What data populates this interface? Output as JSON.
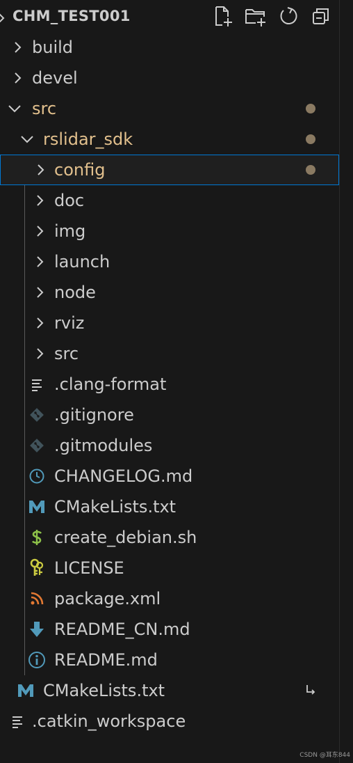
{
  "explorer": {
    "title": "CHM_TEST001",
    "actions": [
      {
        "name": "new-file",
        "icon": "new-file-icon"
      },
      {
        "name": "new-folder",
        "icon": "new-folder-icon"
      },
      {
        "name": "refresh",
        "icon": "refresh-icon"
      },
      {
        "name": "collapse-all",
        "icon": "collapse-all-icon"
      }
    ]
  },
  "tree": [
    {
      "label": "build",
      "type": "folder",
      "expanded": false,
      "depth": 0,
      "modified": false
    },
    {
      "label": "devel",
      "type": "folder",
      "expanded": false,
      "depth": 0,
      "modified": false
    },
    {
      "label": "src",
      "type": "folder",
      "expanded": true,
      "depth": 0,
      "modified": true
    },
    {
      "label": "rslidar_sdk",
      "type": "folder",
      "expanded": true,
      "depth": 1,
      "modified": true
    },
    {
      "label": "config",
      "type": "folder",
      "expanded": false,
      "depth": 2,
      "modified": true,
      "selected": true
    },
    {
      "label": "doc",
      "type": "folder",
      "expanded": false,
      "depth": 2,
      "modified": false
    },
    {
      "label": "img",
      "type": "folder",
      "expanded": false,
      "depth": 2,
      "modified": false
    },
    {
      "label": "launch",
      "type": "folder",
      "expanded": false,
      "depth": 2,
      "modified": false
    },
    {
      "label": "node",
      "type": "folder",
      "expanded": false,
      "depth": 2,
      "modified": false
    },
    {
      "label": "rviz",
      "type": "folder",
      "expanded": false,
      "depth": 2,
      "modified": false
    },
    {
      "label": "src",
      "type": "folder",
      "expanded": false,
      "depth": 2,
      "modified": false
    },
    {
      "label": ".clang-format",
      "type": "file",
      "icon": "lines-icon",
      "depth": 2
    },
    {
      "label": ".gitignore",
      "type": "file",
      "icon": "git-icon",
      "depth": 2
    },
    {
      "label": ".gitmodules",
      "type": "file",
      "icon": "git-icon",
      "depth": 2
    },
    {
      "label": "CHANGELOG.md",
      "type": "file",
      "icon": "clock-icon",
      "depth": 2
    },
    {
      "label": "CMakeLists.txt",
      "type": "file",
      "icon": "cmake-m-icon",
      "depth": 2
    },
    {
      "label": "create_debian.sh",
      "type": "file",
      "icon": "dollar-icon",
      "depth": 2
    },
    {
      "label": "LICENSE",
      "type": "file",
      "icon": "key-icon",
      "depth": 2
    },
    {
      "label": "package.xml",
      "type": "file",
      "icon": "rss-icon",
      "depth": 2
    },
    {
      "label": "README_CN.md",
      "type": "file",
      "icon": "download-arrow-icon",
      "depth": 2
    },
    {
      "label": "README.md",
      "type": "file",
      "icon": "info-icon",
      "depth": 2
    },
    {
      "label": "CMakeLists.txt",
      "type": "file",
      "icon": "cmake-m-icon",
      "depth": 1,
      "symlink": true
    },
    {
      "label": ".catkin_workspace",
      "type": "file",
      "icon": "lines-icon",
      "depth": 0
    }
  ],
  "colors": {
    "background": "#181818",
    "text": "#cccccc",
    "modified": "#e2c08d",
    "selection_border": "#0078d4",
    "dot": "#8a7a62",
    "git": "#41535b",
    "cmake": "#519aba",
    "shell": "#8dc149",
    "rss": "#e37933"
  },
  "watermark": "CSDN @耳东844"
}
